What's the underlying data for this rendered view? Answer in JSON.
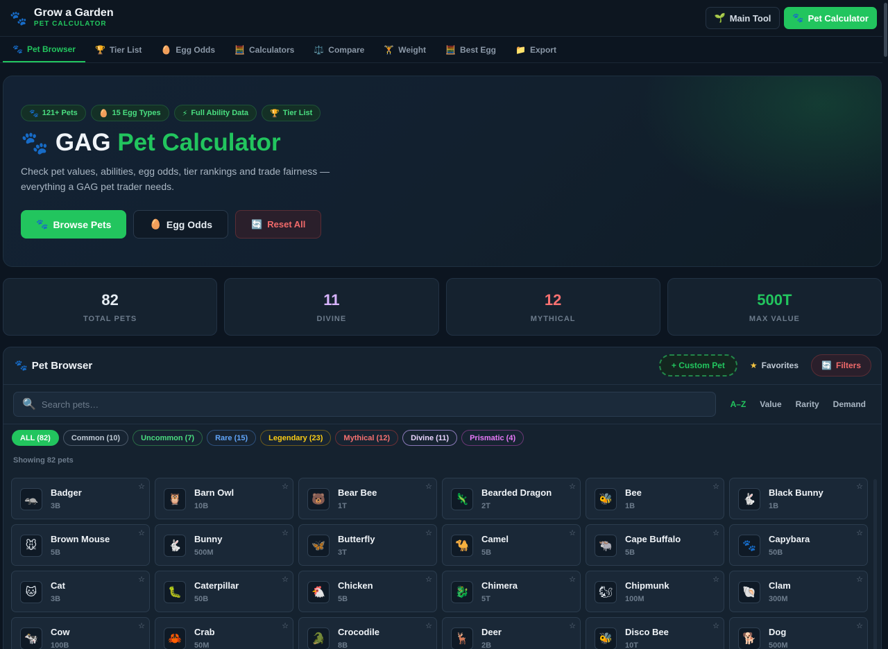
{
  "header": {
    "brand_icon": "🐾",
    "title": "Grow a Garden",
    "subtitle": "PET CALCULATOR",
    "main_tool": {
      "icon": "🌱",
      "label": "Main Tool"
    },
    "pet_calc": {
      "icon": "🐾",
      "label": "Pet Calculator"
    }
  },
  "tabs": [
    {
      "icon": "🐾",
      "label": "Pet Browser",
      "active": true
    },
    {
      "icon": "🏆",
      "label": "Tier List"
    },
    {
      "icon": "🥚",
      "label": "Egg Odds"
    },
    {
      "icon": "🧮",
      "label": "Calculators"
    },
    {
      "icon": "⚖️",
      "label": "Compare"
    },
    {
      "icon": "🏋",
      "label": "Weight"
    },
    {
      "icon": "🧮",
      "label": "Best Egg"
    },
    {
      "icon": "📁",
      "label": "Export"
    }
  ],
  "hero": {
    "badges": [
      {
        "icon": "🐾",
        "label": "121+ Pets"
      },
      {
        "icon": "🥚",
        "label": "15 Egg Types"
      },
      {
        "icon": "⚡",
        "label": "Full Ability Data"
      },
      {
        "icon": "🏆",
        "label": "Tier List"
      }
    ],
    "paw": "🐾",
    "title_white": "GAG",
    "title_green": "Pet Calculator",
    "description": "Check pet values, abilities, egg odds, tier rankings and trade fairness — everything a GAG pet trader needs.",
    "browse": {
      "icon": "🐾",
      "label": "Browse Pets"
    },
    "egg": {
      "icon": "🥚",
      "label": "Egg Odds"
    },
    "reset": {
      "icon": "🔄",
      "label": "Reset All"
    }
  },
  "stats": [
    {
      "value": "82",
      "label": "TOTAL PETS",
      "color": "#e6edf3"
    },
    {
      "value": "11",
      "label": "DIVINE",
      "color": "#d8b4fe"
    },
    {
      "value": "12",
      "label": "MYTHICAL",
      "color": "#f87171"
    },
    {
      "value": "500T",
      "label": "MAX VALUE",
      "color": "#22c55e"
    }
  ],
  "browser": {
    "icon": "🐾",
    "title": "Pet Browser",
    "custom_pet": "+ Custom Pet",
    "favorites": {
      "icon": "★",
      "label": "Favorites"
    },
    "filters": {
      "icon": "🔄",
      "label": "Filters"
    },
    "search_icon": "🔍",
    "search_placeholder": "Search pets…",
    "sorts": [
      {
        "label": "A–Z",
        "active": true
      },
      {
        "label": "Value"
      },
      {
        "label": "Rarity"
      },
      {
        "label": "Demand"
      }
    ],
    "chips": [
      {
        "label": "ALL (82)",
        "color": "#ffffff",
        "bg": "#22c55e",
        "border": "#22c55e"
      },
      {
        "label": "Common (10)",
        "color": "#c0cad5",
        "bg": "#172432",
        "border": "#4a5868"
      },
      {
        "label": "Uncommon (7)",
        "color": "#4ade80",
        "bg": "#172432",
        "border": "#2a6a45"
      },
      {
        "label": "Rare (15)",
        "color": "#60a5fa",
        "bg": "#172432",
        "border": "#2d4f7a"
      },
      {
        "label": "Legendary (23)",
        "color": "#facc15",
        "bg": "#172432",
        "border": "#6b5a1d"
      },
      {
        "label": "Mythical (12)",
        "color": "#f87171",
        "bg": "#172432",
        "border": "#6b2f35"
      },
      {
        "label": "Divine (11)",
        "color": "#e9d5ff",
        "bg": "#172432",
        "border": "#8a79b8"
      },
      {
        "label": "Prismatic (4)",
        "color": "#e879f9",
        "bg": "#172432",
        "border": "#6a3775"
      }
    ],
    "showing": "Showing 82 pets",
    "star": "☆",
    "pets": [
      {
        "icon": "🦡",
        "name": "Badger",
        "value": "3B"
      },
      {
        "icon": "🦉",
        "name": "Barn Owl",
        "value": "10B"
      },
      {
        "icon": "🐻",
        "name": "Bear Bee",
        "value": "1T"
      },
      {
        "icon": "🦎",
        "name": "Bearded Dragon",
        "value": "2T"
      },
      {
        "icon": "🐝",
        "name": "Bee",
        "value": "1B"
      },
      {
        "icon": "🐇",
        "name": "Black Bunny",
        "value": "1B"
      },
      {
        "icon": "🐭",
        "name": "Brown Mouse",
        "value": "5B"
      },
      {
        "icon": "🐇",
        "name": "Bunny",
        "value": "500M"
      },
      {
        "icon": "🦋",
        "name": "Butterfly",
        "value": "3T"
      },
      {
        "icon": "🐪",
        "name": "Camel",
        "value": "5B"
      },
      {
        "icon": "🐃",
        "name": "Cape Buffalo",
        "value": "5B"
      },
      {
        "icon": "🐾",
        "name": "Capybara",
        "value": "50B"
      },
      {
        "icon": "🐱",
        "name": "Cat",
        "value": "3B"
      },
      {
        "icon": "🐛",
        "name": "Caterpillar",
        "value": "50B"
      },
      {
        "icon": "🐔",
        "name": "Chicken",
        "value": "5B"
      },
      {
        "icon": "🐉",
        "name": "Chimera",
        "value": "5T"
      },
      {
        "icon": "🐿",
        "name": "Chipmunk",
        "value": "100M"
      },
      {
        "icon": "🐚",
        "name": "Clam",
        "value": "300M"
      },
      {
        "icon": "🐄",
        "name": "Cow",
        "value": "100B"
      },
      {
        "icon": "🦀",
        "name": "Crab",
        "value": "50M"
      },
      {
        "icon": "🐊",
        "name": "Crocodile",
        "value": "8B"
      },
      {
        "icon": "🦌",
        "name": "Deer",
        "value": "2B"
      },
      {
        "icon": "🐝",
        "name": "Disco Bee",
        "value": "10T"
      },
      {
        "icon": "🐕",
        "name": "Dog",
        "value": "500M"
      }
    ]
  }
}
